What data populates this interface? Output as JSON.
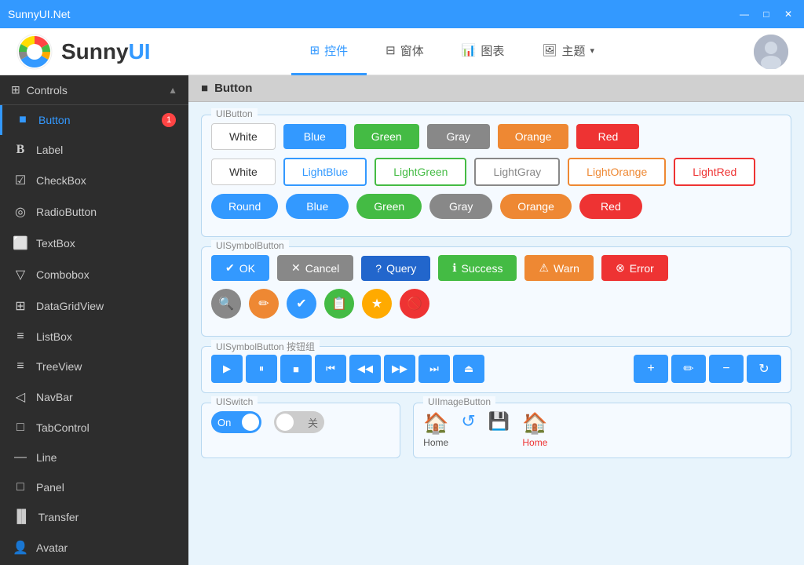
{
  "titlebar": {
    "title": "SunnyUI.Net",
    "minimize": "—",
    "maximize": "□",
    "close": "✕"
  },
  "header": {
    "logo_text_black": "Sunny",
    "logo_text_blue": "UI",
    "nav_tabs": [
      {
        "id": "controls",
        "icon": "⊞",
        "label": "控件",
        "active": true
      },
      {
        "id": "windows",
        "icon": "⊟",
        "label": "窗体",
        "active": false
      },
      {
        "id": "charts",
        "icon": "📊",
        "label": "图表",
        "active": false
      },
      {
        "id": "themes",
        "icon": "🖼",
        "label": "主题",
        "active": false
      }
    ]
  },
  "sidebar": {
    "header_label": "Controls",
    "items": [
      {
        "id": "button",
        "icon": "■",
        "label": "Button",
        "badge": "1",
        "active": true
      },
      {
        "id": "label",
        "icon": "B",
        "label": "Label",
        "badge": null,
        "active": false
      },
      {
        "id": "checkbox",
        "icon": "✓",
        "label": "CheckBox",
        "badge": null,
        "active": false
      },
      {
        "id": "radiobutton",
        "icon": "◎",
        "label": "RadioButton",
        "badge": null,
        "active": false
      },
      {
        "id": "textbox",
        "icon": "⬜",
        "label": "TextBox",
        "badge": null,
        "active": false
      },
      {
        "id": "combobox",
        "icon": "▽",
        "label": "Combobox",
        "badge": null,
        "active": false
      },
      {
        "id": "datagridview",
        "icon": "⊞",
        "label": "DataGridView",
        "badge": null,
        "active": false
      },
      {
        "id": "listbox",
        "icon": "≡",
        "label": "ListBox",
        "badge": null,
        "active": false
      },
      {
        "id": "treeview",
        "icon": "≡",
        "label": "TreeView",
        "badge": null,
        "active": false
      },
      {
        "id": "navbar",
        "icon": "◁",
        "label": "NavBar",
        "badge": null,
        "active": false
      },
      {
        "id": "tabcontrol",
        "icon": "□",
        "label": "TabControl",
        "badge": null,
        "active": false
      },
      {
        "id": "line",
        "icon": "—",
        "label": "Line",
        "badge": null,
        "active": false
      },
      {
        "id": "panel",
        "icon": "□",
        "label": "Panel",
        "badge": null,
        "active": false
      },
      {
        "id": "transfer",
        "icon": "▐▌",
        "label": "Transfer",
        "badge": null,
        "active": false
      },
      {
        "id": "avatar",
        "icon": "👤",
        "label": "Avatar",
        "badge": null,
        "active": false
      }
    ]
  },
  "content": {
    "page_title": "Button",
    "sections": {
      "uibutton": {
        "label": "UIButton",
        "row1": [
          "White",
          "Blue",
          "Green",
          "Gray",
          "Orange",
          "Red"
        ],
        "row2": [
          "White",
          "LightBlue",
          "LightGreen",
          "LightGray",
          "LightOrange",
          "LightRed"
        ],
        "row3": [
          "Round",
          "Blue",
          "Green",
          "Gray",
          "Orange",
          "Red"
        ]
      },
      "uisymbolbutton": {
        "label": "UISymbolButton",
        "row1_buttons": [
          {
            "icon": "✔",
            "label": "OK",
            "style": "blue"
          },
          {
            "icon": "✕",
            "label": "Cancel",
            "style": "gray"
          },
          {
            "icon": "?",
            "label": "Query",
            "style": "bluedark"
          },
          {
            "icon": "ℹ",
            "label": "Success",
            "style": "green"
          },
          {
            "icon": "⚠",
            "label": "Warn",
            "style": "orange"
          },
          {
            "icon": "⊗",
            "label": "Error",
            "style": "red"
          }
        ],
        "row2_icons": [
          "🔍",
          "✏",
          "✔",
          "📋",
          "★",
          "🚫"
        ]
      },
      "uisymbolbutton_group": {
        "label": "UISymbolButton 按钮组",
        "media_buttons": [
          "▶",
          "⏸",
          "■",
          "⏮",
          "◀◀",
          "▶▶",
          "⏭",
          "⏏"
        ],
        "action_buttons": [
          "+",
          "✏",
          "−",
          "↻"
        ]
      },
      "uiswitch": {
        "label": "UISwitch",
        "on_label": "On",
        "off_label": "关"
      },
      "uiimagebutton": {
        "label": "UIImageButton",
        "buttons": [
          {
            "icon": "🏠",
            "label": "Home",
            "color": "blue"
          },
          {
            "icon": "↺",
            "label": "",
            "color": "blue"
          },
          {
            "icon": "💾",
            "label": "",
            "color": "blue"
          },
          {
            "icon": "🏠",
            "label": "Home",
            "color": "red"
          }
        ]
      }
    }
  }
}
